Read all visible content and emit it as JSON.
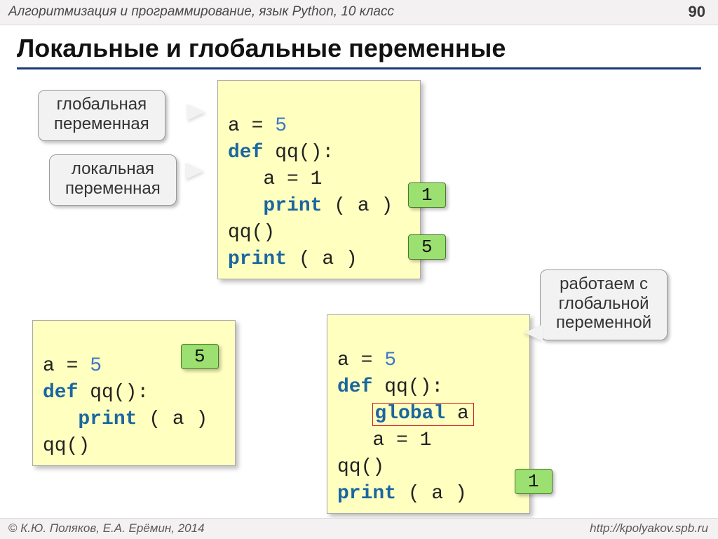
{
  "header": {
    "subject": "Алгоритмизация и программирование, язык Python, 10 класс",
    "page_number": "90"
  },
  "title": "Локальные и глобальные переменные",
  "callouts": {
    "global_var": "глобальная\nпеременная",
    "local_var": "локальная\nпеременная",
    "work_global": "работаем с\nглобальной\nпеременной"
  },
  "code1": {
    "l1_a": "a",
    "l1_eq": " = ",
    "l1_v": "5",
    "l2_def": "def",
    "l2_rest": " qq():",
    "l3": "   a = 1",
    "l4_indent": "   ",
    "l4_print": "print",
    "l4_rest": " ( a )",
    "l5": "qq()",
    "l6_print": "print",
    "l6_rest": " ( a )"
  },
  "code2": {
    "l1_a": "a",
    "l1_eq": " = ",
    "l1_v": "5",
    "l2_def": "def",
    "l2_rest": " qq():",
    "l3_indent": "   ",
    "l3_print": "print",
    "l3_rest": " ( a )",
    "l4": "qq()"
  },
  "code3": {
    "l1_a": "a",
    "l1_eq": " = ",
    "l1_v": "5",
    "l2_def": "def",
    "l2_rest": " qq():",
    "l3_indent": "   ",
    "l3_global": "global",
    "l3_rest": " a",
    "l4": "   a = 1",
    "l5": "qq()",
    "l6_print": "print",
    "l6_rest": " ( a )"
  },
  "badges": {
    "b1": "1",
    "b5a": "5",
    "b5b": "5",
    "b1b": "1"
  },
  "footer": {
    "copyright_symbol": "©",
    "left": " К.Ю. Поляков, Е.А. Ерёмин, 2014",
    "right": "http://kpolyakov.spb.ru"
  }
}
